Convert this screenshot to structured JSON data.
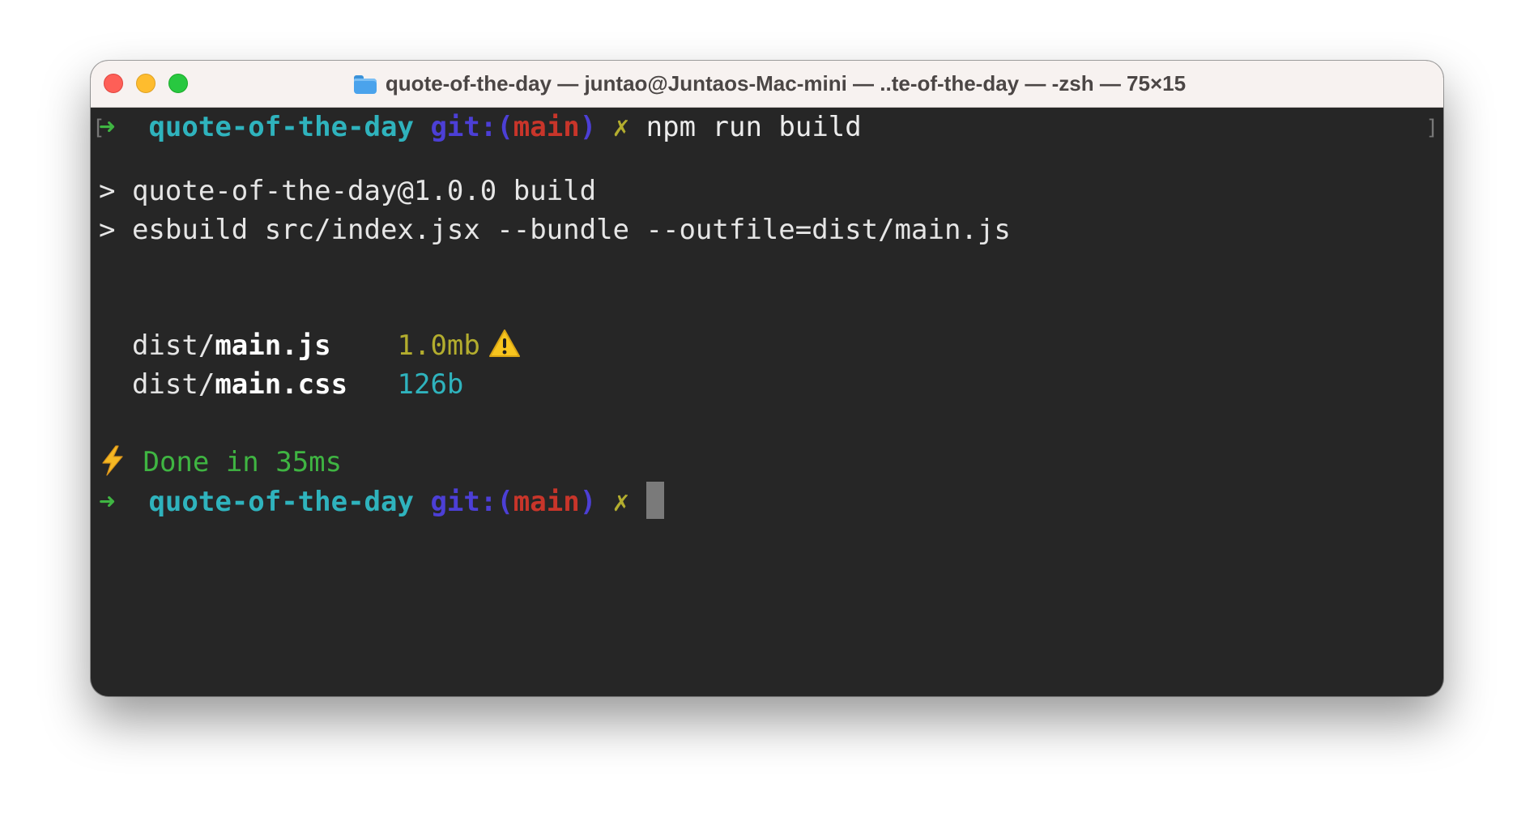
{
  "window": {
    "title": "quote-of-the-day — juntao@Juntaos-Mac-mini — ..te-of-the-day — -zsh — 75×15",
    "title_icon": "folder-icon"
  },
  "terminal": {
    "prompt1": {
      "arrow": "➜",
      "dir": "quote-of-the-day",
      "git_label": "git:(",
      "branch": "main",
      "git_close": ")",
      "dirty": "✗",
      "command": "npm run build"
    },
    "output": {
      "line1": "> quote-of-the-day@1.0.0 build",
      "line2": "> esbuild src/index.jsx --bundle --outfile=dist/main.js"
    },
    "files": [
      {
        "dir": "dist/",
        "name": "main.js",
        "size": "1.0mb",
        "warning": true
      },
      {
        "dir": "dist/",
        "name": "main.css",
        "size": "126b",
        "warning": false
      }
    ],
    "done": {
      "icon": "lightning-icon",
      "text": "Done in 35ms"
    },
    "prompt2": {
      "arrow": "➜",
      "dir": "quote-of-the-day",
      "git_label": "git:(",
      "branch": "main",
      "git_close": ")",
      "dirty": "✗"
    }
  }
}
